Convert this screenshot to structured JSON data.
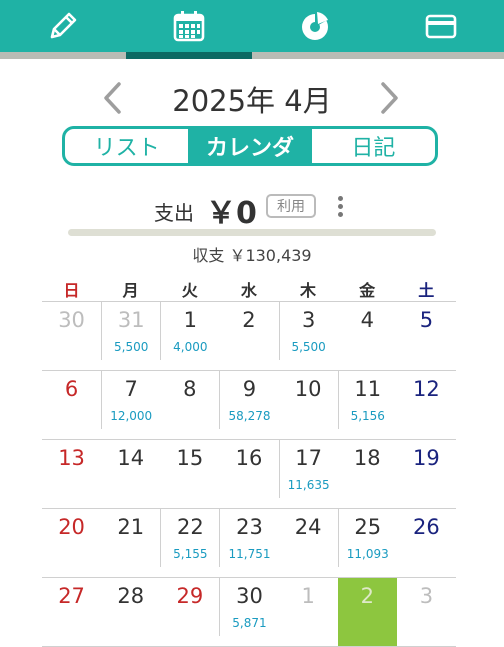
{
  "colors": {
    "accent": "#1fb2a5",
    "accent_dark": "#0c6a63",
    "sunday": "#c62828",
    "saturday": "#1a237e",
    "amount": "#1a9bc0",
    "selected": "#8dc63f"
  },
  "tabs": [
    {
      "icon": "pencil-icon"
    },
    {
      "icon": "calendar-icon",
      "active": true
    },
    {
      "icon": "pie-chart-icon"
    },
    {
      "icon": "credit-card-icon"
    }
  ],
  "header": {
    "month": "2025年 4月",
    "prev_icon": "chevron-left-icon",
    "next_icon": "chevron-right-icon"
  },
  "view_switch": {
    "list": "リスト",
    "calendar": "カレンダ",
    "diary": "日記",
    "active": "calendar"
  },
  "summary": {
    "expense_label": "支出",
    "expense_amount": "￥0",
    "usage_badge": "利用",
    "progress": 0,
    "balance": "収支 ￥130,439"
  },
  "weekdays": [
    "日",
    "月",
    "火",
    "水",
    "木",
    "金",
    "土"
  ],
  "weeks": [
    [
      {
        "day": "30",
        "amount": "",
        "other": true
      },
      {
        "day": "31",
        "amount": "5,500",
        "other": true
      },
      {
        "day": "1",
        "amount": "4,000"
      },
      {
        "day": "2",
        "amount": ""
      },
      {
        "day": "3",
        "amount": "5,500"
      },
      {
        "day": "4",
        "amount": ""
      },
      {
        "day": "5",
        "amount": ""
      }
    ],
    [
      {
        "day": "6",
        "amount": ""
      },
      {
        "day": "7",
        "amount": "12,000"
      },
      {
        "day": "8",
        "amount": ""
      },
      {
        "day": "9",
        "amount": "58,278"
      },
      {
        "day": "10",
        "amount": ""
      },
      {
        "day": "11",
        "amount": "5,156"
      },
      {
        "day": "12",
        "amount": ""
      }
    ],
    [
      {
        "day": "13",
        "amount": ""
      },
      {
        "day": "14",
        "amount": ""
      },
      {
        "day": "15",
        "amount": ""
      },
      {
        "day": "16",
        "amount": ""
      },
      {
        "day": "17",
        "amount": "11,635"
      },
      {
        "day": "18",
        "amount": ""
      },
      {
        "day": "19",
        "amount": ""
      }
    ],
    [
      {
        "day": "20",
        "amount": ""
      },
      {
        "day": "21",
        "amount": ""
      },
      {
        "day": "22",
        "amount": "5,155"
      },
      {
        "day": "23",
        "amount": "11,751"
      },
      {
        "day": "24",
        "amount": ""
      },
      {
        "day": "25",
        "amount": "11,093"
      },
      {
        "day": "26",
        "amount": ""
      }
    ],
    [
      {
        "day": "27",
        "amount": ""
      },
      {
        "day": "28",
        "amount": ""
      },
      {
        "day": "29",
        "amount": ""
      },
      {
        "day": "30",
        "amount": "5,871"
      },
      {
        "day": "1",
        "amount": "",
        "other": true
      },
      {
        "day": "2",
        "amount": "",
        "other": true,
        "selected": true
      },
      {
        "day": "3",
        "amount": "",
        "other": true
      }
    ]
  ],
  "holidays": [
    "29"
  ]
}
